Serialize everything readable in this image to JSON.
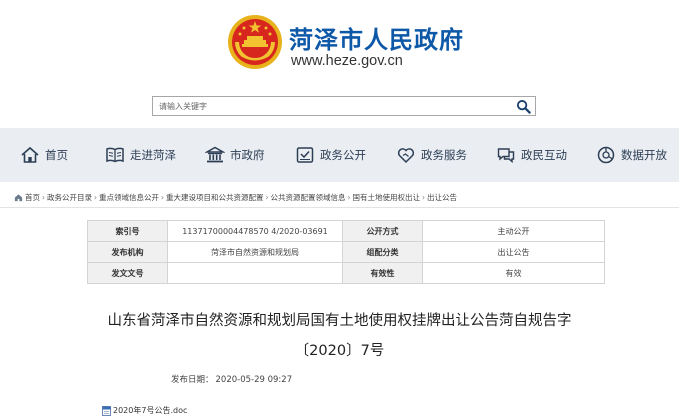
{
  "header": {
    "site_title": "菏泽市人民政府",
    "site_url": "www.heze.gov.cn",
    "emblem_icon": "national-emblem-icon"
  },
  "search": {
    "placeholder": "请输入关键字",
    "button_icon": "search-icon"
  },
  "nav": {
    "items": [
      {
        "label": "首页",
        "icon": "home-icon"
      },
      {
        "label": "走进菏泽",
        "icon": "book-icon"
      },
      {
        "label": "市政府",
        "icon": "building-icon"
      },
      {
        "label": "政务公开",
        "icon": "document-icon"
      },
      {
        "label": "政务服务",
        "icon": "handshake-icon"
      },
      {
        "label": "政民互动",
        "icon": "chat-icon"
      },
      {
        "label": "数据开放",
        "icon": "data-icon"
      }
    ]
  },
  "breadcrumb": {
    "items": [
      "首页",
      "政务公开目录",
      "重点领域信息公开",
      "重大建设项目和公共资源配置",
      "公共资源配置领域信息",
      "国有土地使用权出让",
      "出让公告"
    ]
  },
  "meta": {
    "rows": [
      {
        "l1": "索引号",
        "v1": "11371700004478570 4/2020-03691",
        "l2": "公开方式",
        "v2": "主动公开"
      },
      {
        "l1": "发布机构",
        "v1": "菏泽市自然资源和规划局",
        "l2": "组配分类",
        "v2": "出让公告"
      },
      {
        "l1": "发文文号",
        "v1": "",
        "l2": "有效性",
        "v2": "有效"
      }
    ]
  },
  "document": {
    "title_line1": "山东省菏泽市自然资源和规划局国有土地使用权挂牌出让公告菏自规告字",
    "title_line2": "〔2020〕7号",
    "publish_label": "发布日期：",
    "publish_date": "2020-05-29 09:27"
  },
  "attachment": {
    "name": "2020年7号公告.doc",
    "icon": "word-file-icon"
  },
  "colors": {
    "brand_blue": "#0e58a8",
    "nav_bg": "#eaeef2",
    "table_label_bg": "#f0f0f0"
  }
}
